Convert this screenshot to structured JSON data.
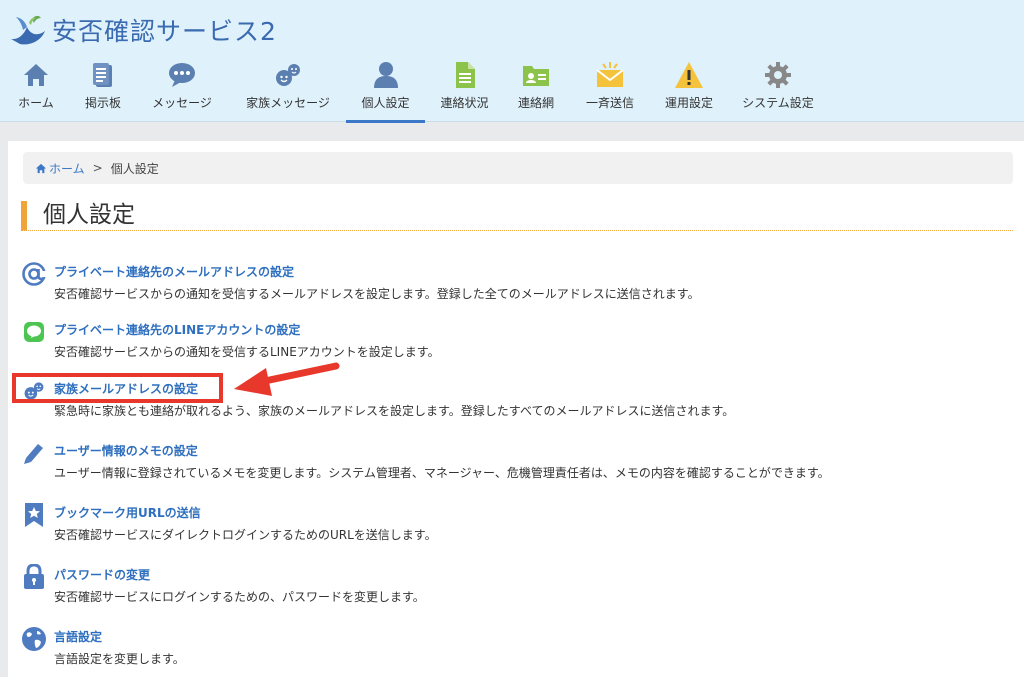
{
  "app": {
    "title": "安否確認サービス2"
  },
  "nav": [
    {
      "label": "ホーム",
      "icon": "home-icon"
    },
    {
      "label": "掲示板",
      "icon": "clipboard-icon"
    },
    {
      "label": "メッセージ",
      "icon": "chat-bubble-icon"
    },
    {
      "label": "家族メッセージ",
      "icon": "family-faces-icon"
    },
    {
      "label": "個人設定",
      "icon": "person-icon",
      "active": true
    },
    {
      "label": "連絡状況",
      "icon": "document-icon"
    },
    {
      "label": "連絡網",
      "icon": "contact-folder-icon"
    },
    {
      "label": "一斉送信",
      "icon": "envelope-broadcast-icon"
    },
    {
      "label": "運用設定",
      "icon": "warning-icon"
    },
    {
      "label": "システム設定",
      "icon": "gear-icon"
    }
  ],
  "breadcrumb": {
    "home": "ホーム",
    "separator": ">",
    "current": "個人設定"
  },
  "page": {
    "title": "個人設定"
  },
  "settings": [
    {
      "title": "プライベート連絡先のメールアドレスの設定",
      "description": "安否確認サービスからの通知を受信するメールアドレスを設定します。登録した全てのメールアドレスに送信されます。",
      "icon": "at-sign-icon"
    },
    {
      "title": "プライベート連絡先のLINEアカウントの設定",
      "description": "安否確認サービスからの通知を受信するLINEアカウントを設定します。",
      "icon": "line-icon"
    },
    {
      "title": "家族メールアドレスの設定",
      "description": "緊急時に家族とも連絡が取れるよう、家族のメールアドレスを設定します。登録したすべてのメールアドレスに送信されます。",
      "icon": "family-faces-icon",
      "highlighted": true
    },
    {
      "title": "ユーザー情報のメモの設定",
      "description": "ユーザー情報に登録されているメモを変更します。システム管理者、マネージャー、危機管理責任者は、メモの内容を確認することができます。",
      "icon": "pencil-icon"
    },
    {
      "title": "ブックマーク用URLの送信",
      "description": "安否確認サービスにダイレクトログインするためのURLを送信します。",
      "icon": "bookmark-icon"
    },
    {
      "title": "パスワードの変更",
      "description": "安否確認サービスにログインするための、パスワードを変更します。",
      "icon": "lock-icon"
    },
    {
      "title": "言語設定",
      "description": "言語設定を変更します。",
      "icon": "globe-icon"
    }
  ],
  "colors": {
    "accent": "#3d78c8",
    "link": "#2f6fbf",
    "title_bar": "#f0a43a",
    "highlight": "#e8382b",
    "header_bg": "#dff1fb"
  }
}
